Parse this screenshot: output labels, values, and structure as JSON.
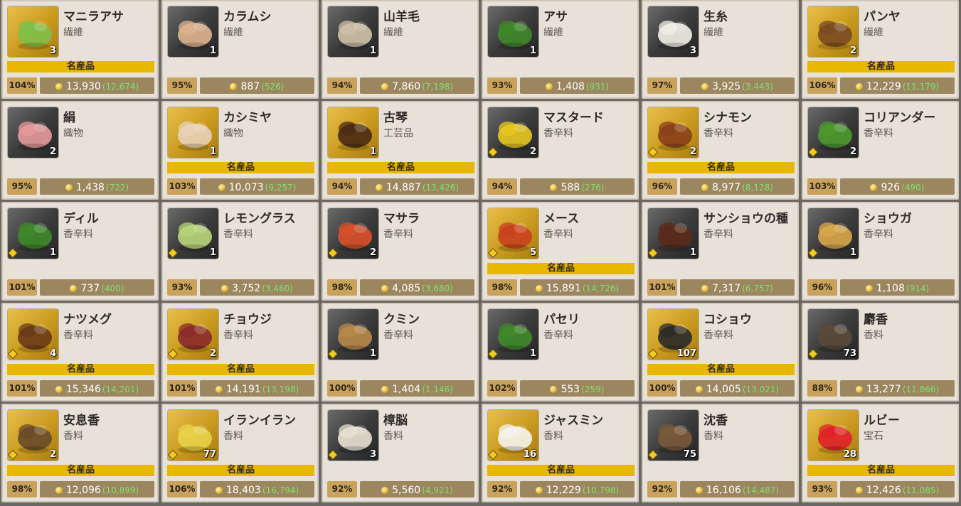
{
  "cards": [
    {
      "id": "abaca",
      "name": "マニラアサ",
      "category": "繊維",
      "qty": "3",
      "badge": "名産品",
      "percent": "104%",
      "price": "13,930",
      "base": "(12,674)",
      "icon": "abaca-icon",
      "bg": "gold",
      "art": "#7fbf4a",
      "diamond": false
    },
    {
      "id": "karamushi",
      "name": "カラムシ",
      "category": "繊維",
      "qty": "1",
      "badge": "",
      "percent": "95%",
      "price": "887",
      "base": "(526)",
      "icon": "ramie-icon",
      "bg": "dark",
      "art": "#e0b48f",
      "diamond": false
    },
    {
      "id": "wool",
      "name": "山羊毛",
      "category": "繊維",
      "qty": "1",
      "badge": "",
      "percent": "94%",
      "price": "7,860",
      "base": "(7,198)",
      "icon": "goat-wool-icon",
      "bg": "dark",
      "art": "#cfc2a8",
      "diamond": false
    },
    {
      "id": "hemp",
      "name": "アサ",
      "category": "繊維",
      "qty": "1",
      "badge": "",
      "percent": "93%",
      "price": "1,408",
      "base": "(931)",
      "icon": "hemp-leaf-icon",
      "bg": "dark",
      "art": "#3f8a2a",
      "diamond": false
    },
    {
      "id": "raw-silk",
      "name": "生糸",
      "category": "繊維",
      "qty": "3",
      "badge": "",
      "percent": "97%",
      "price": "3,925",
      "base": "(3,443)",
      "icon": "raw-silk-icon",
      "bg": "dark",
      "art": "#f2efe6",
      "diamond": false
    },
    {
      "id": "panya",
      "name": "パンヤ",
      "category": "繊維",
      "qty": "2",
      "badge": "名産品",
      "percent": "106%",
      "price": "12,229",
      "base": "(11,179)",
      "icon": "kapok-icon",
      "bg": "gold",
      "art": "#7a4a22",
      "diamond": false
    },
    {
      "id": "silk",
      "name": "絹",
      "category": "織物",
      "qty": "2",
      "badge": "",
      "percent": "95%",
      "price": "1,438",
      "base": "(722)",
      "icon": "silk-cloth-icon",
      "bg": "dark",
      "art": "#e59a9a",
      "diamond": false
    },
    {
      "id": "cashmere",
      "name": "カシミヤ",
      "category": "織物",
      "qty": "1",
      "badge": "名産品",
      "percent": "103%",
      "price": "10,073",
      "base": "(9,257)",
      "icon": "cashmere-cloth-icon",
      "bg": "gold",
      "art": "#e8d2b8",
      "diamond": false
    },
    {
      "id": "kokin",
      "name": "古琴",
      "category": "工芸品",
      "qty": "1",
      "badge": "名産品",
      "percent": "94%",
      "price": "14,887",
      "base": "(13,426)",
      "icon": "guqin-icon",
      "bg": "gold",
      "art": "#4a2a14",
      "diamond": false
    },
    {
      "id": "mustard",
      "name": "マスタード",
      "category": "香辛料",
      "qty": "2",
      "badge": "",
      "percent": "94%",
      "price": "588",
      "base": "(276)",
      "icon": "mustard-flower-icon",
      "bg": "dark",
      "art": "#e8c820",
      "diamond": true
    },
    {
      "id": "cinnamon",
      "name": "シナモン",
      "category": "香辛料",
      "qty": "2",
      "badge": "名産品",
      "percent": "96%",
      "price": "8,977",
      "base": "(8,128)",
      "icon": "cinnamon-stick-icon",
      "bg": "gold",
      "art": "#8a3f1a",
      "diamond": true
    },
    {
      "id": "coriander",
      "name": "コリアンダー",
      "category": "香辛料",
      "qty": "2",
      "badge": "",
      "percent": "103%",
      "price": "926",
      "base": "(490)",
      "icon": "coriander-leaf-icon",
      "bg": "dark",
      "art": "#4e9a2e",
      "diamond": true
    },
    {
      "id": "dill",
      "name": "ディル",
      "category": "香辛料",
      "qty": "1",
      "badge": "",
      "percent": "101%",
      "price": "737",
      "base": "(400)",
      "icon": "dill-icon",
      "bg": "dark",
      "art": "#3f8a2a",
      "diamond": true
    },
    {
      "id": "lemongrass",
      "name": "レモングラス",
      "category": "香辛料",
      "qty": "1",
      "badge": "",
      "percent": "93%",
      "price": "3,752",
      "base": "(3,460)",
      "icon": "lemongrass-icon",
      "bg": "dark",
      "art": "#b9d67a",
      "diamond": true
    },
    {
      "id": "masala",
      "name": "マサラ",
      "category": "香辛料",
      "qty": "2",
      "badge": "",
      "percent": "98%",
      "price": "4,085",
      "base": "(3,680)",
      "icon": "masala-icon",
      "bg": "dark",
      "art": "#d8502a",
      "diamond": true
    },
    {
      "id": "mace",
      "name": "メース",
      "category": "香辛料",
      "qty": "5",
      "badge": "名産品",
      "percent": "98%",
      "price": "15,891",
      "base": "(14,726)",
      "icon": "mace-icon",
      "bg": "gold",
      "art": "#c8401f",
      "diamond": true
    },
    {
      "id": "sansho",
      "name": "サンショウの種",
      "category": "香辛料",
      "qty": "1",
      "badge": "",
      "percent": "101%",
      "price": "7,317",
      "base": "(6,757)",
      "icon": "sansho-seed-icon",
      "bg": "dark",
      "art": "#5a2a1a",
      "diamond": true
    },
    {
      "id": "ginger",
      "name": "ショウガ",
      "category": "香辛料",
      "qty": "1",
      "badge": "",
      "percent": "96%",
      "price": "1,108",
      "base": "(914)",
      "icon": "ginger-root-icon",
      "bg": "dark",
      "art": "#d9a84a",
      "diamond": true
    },
    {
      "id": "nutmeg",
      "name": "ナツメグ",
      "category": "香辛料",
      "qty": "4",
      "badge": "名産品",
      "percent": "101%",
      "price": "15,346",
      "base": "(14,201)",
      "icon": "nutmeg-icon",
      "bg": "gold",
      "art": "#6a3a1a",
      "diamond": true
    },
    {
      "id": "clove",
      "name": "チョウジ",
      "category": "香辛料",
      "qty": "2",
      "badge": "名産品",
      "percent": "101%",
      "price": "14,191",
      "base": "(13,198)",
      "icon": "clove-icon",
      "bg": "gold",
      "art": "#8a2a2a",
      "diamond": true
    },
    {
      "id": "cumin",
      "name": "クミン",
      "category": "香辛料",
      "qty": "1",
      "badge": "",
      "percent": "100%",
      "price": "1,404",
      "base": "(1,146)",
      "icon": "cumin-icon",
      "bg": "dark",
      "art": "#b88a4a",
      "diamond": true
    },
    {
      "id": "parsley",
      "name": "パセリ",
      "category": "香辛料",
      "qty": "1",
      "badge": "",
      "percent": "102%",
      "price": "553",
      "base": "(259)",
      "icon": "parsley-icon",
      "bg": "dark",
      "art": "#3f8a2a",
      "diamond": true
    },
    {
      "id": "pepper",
      "name": "コショウ",
      "category": "香辛料",
      "qty": "107",
      "badge": "名産品",
      "percent": "100%",
      "price": "14,005",
      "base": "(13,021)",
      "icon": "peppercorn-icon",
      "bg": "gold",
      "art": "#2a2a2a",
      "diamond": true
    },
    {
      "id": "musk",
      "name": "麝香",
      "category": "香料",
      "qty": "73",
      "badge": "",
      "percent": "88%",
      "price": "13,277",
      "base": "(11,866)",
      "icon": "musk-incense-icon",
      "bg": "dark",
      "art": "#5a4a3a",
      "diamond": true
    },
    {
      "id": "benzoin",
      "name": "安息香",
      "category": "香料",
      "qty": "2",
      "badge": "名産品",
      "percent": "98%",
      "price": "12,096",
      "base": "(10,899)",
      "icon": "benzoin-icon",
      "bg": "gold",
      "art": "#6a4a2a",
      "diamond": true
    },
    {
      "id": "ylang",
      "name": "イランイラン",
      "category": "香料",
      "qty": "77",
      "badge": "名産品",
      "percent": "106%",
      "price": "18,403",
      "base": "(16,794)",
      "icon": "ylang-flower-icon",
      "bg": "gold",
      "art": "#e8d24a",
      "diamond": true
    },
    {
      "id": "camphor",
      "name": "樟脳",
      "category": "香料",
      "qty": "3",
      "badge": "",
      "percent": "92%",
      "price": "5,560",
      "base": "(4,921)",
      "icon": "camphor-icon",
      "bg": "dark",
      "art": "#e8e2d2",
      "diamond": true
    },
    {
      "id": "jasmine",
      "name": "ジャスミン",
      "category": "香料",
      "qty": "16",
      "badge": "名産品",
      "percent": "92%",
      "price": "12,229",
      "base": "(10,798)",
      "icon": "jasmine-flower-icon",
      "bg": "gold",
      "art": "#f4f4ee",
      "diamond": true
    },
    {
      "id": "agarwood",
      "name": "沈香",
      "category": "香料",
      "qty": "75",
      "badge": "",
      "percent": "92%",
      "price": "16,106",
      "base": "(14,487)",
      "icon": "agarwood-icon",
      "bg": "dark",
      "art": "#7a5a3a",
      "diamond": true
    },
    {
      "id": "ruby",
      "name": "ルビー",
      "category": "宝石",
      "qty": "28",
      "badge": "名産品",
      "percent": "93%",
      "price": "12,426",
      "base": "(11,085)",
      "icon": "ruby-gem-icon",
      "bg": "gold",
      "art": "#e0202a",
      "diamond": false
    }
  ]
}
